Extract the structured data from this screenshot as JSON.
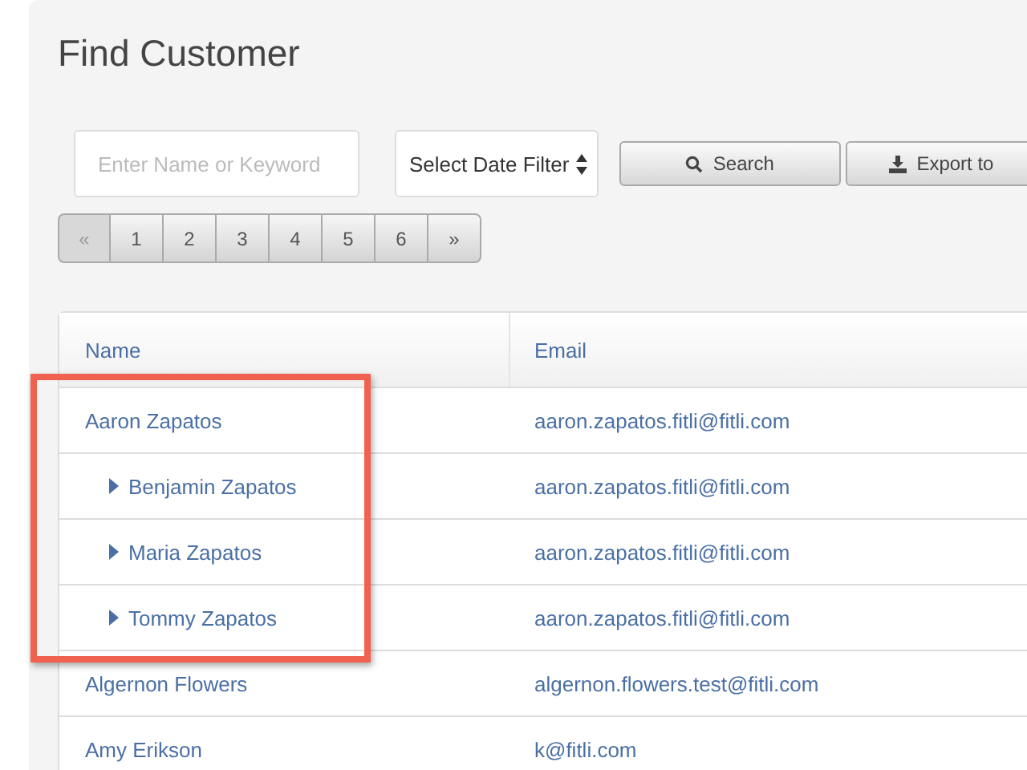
{
  "title": "Find Customer",
  "search": {
    "placeholder": "Enter Name or Keyword"
  },
  "date_filter": {
    "value": "Select Date Filter"
  },
  "buttons": [
    {
      "kind": "search",
      "label": "Search"
    },
    {
      "kind": "export",
      "label": "Export to"
    }
  ],
  "pagination": [
    {
      "label": "«",
      "disabled": true
    },
    {
      "label": "1",
      "disabled": false
    },
    {
      "label": "2",
      "disabled": false
    },
    {
      "label": "3",
      "disabled": false
    },
    {
      "label": "4",
      "disabled": false
    },
    {
      "label": "5",
      "disabled": false
    },
    {
      "label": "6",
      "disabled": false
    },
    {
      "label": "»",
      "disabled": false
    }
  ],
  "table": {
    "columns": [
      "Name",
      "Email"
    ],
    "rows": [
      {
        "name": "Aaron Zapatos",
        "email": "aaron.zapatos.fitli@fitli.com",
        "children": [
          {
            "name": "Benjamin Zapatos",
            "email": "aaron.zapatos.fitli@fitli.com",
            "expanded": false
          },
          {
            "name": "Maria Zapatos",
            "email": "aaron.zapatos.fitli@fitli.com",
            "expanded": false
          },
          {
            "name": "Tommy Zapatos",
            "email": "aaron.zapatos.fitli@fitli.com",
            "expanded": false
          }
        ]
      },
      {
        "name": "Algernon Flowers",
        "email": "algernon.flowers.test@fitli.com"
      },
      {
        "name": "Amy Erikson",
        "email": "k@fitli.com"
      }
    ]
  }
}
